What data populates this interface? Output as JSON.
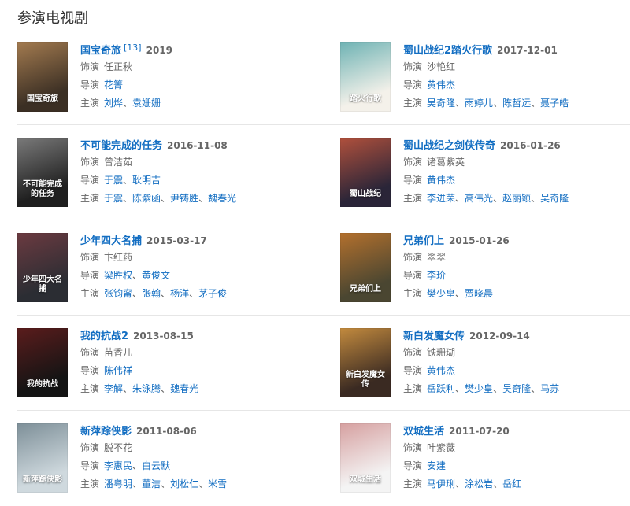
{
  "section": {
    "title": "参演电视剧"
  },
  "rows": [
    [
      {
        "title": "国宝奇旅",
        "sup": "[13]",
        "date": "2019",
        "role_label": "饰演",
        "role": "任正秋",
        "director_label": "导演",
        "directors": [
          "花箐"
        ],
        "cast_label": "主演",
        "cast": [
          "刘烨",
          "袁姗姗"
        ],
        "poster_colors": [
          "#3b2f24",
          "#a27a4f"
        ],
        "poster_text": "国宝奇旅"
      },
      {
        "title": "蜀山战纪2踏火行歌",
        "date": "2017-12-01",
        "role_label": "饰演",
        "role": "沙艳红",
        "director_label": "导演",
        "directors": [
          "黄伟杰"
        ],
        "cast_label": "主演",
        "cast": [
          "吴奇隆",
          "雨婷儿",
          "陈哲远",
          "聂子皓"
        ],
        "poster_colors": [
          "#f4f1ea",
          "#6fb3b4"
        ],
        "poster_text": "踏火行歌"
      }
    ],
    [
      {
        "title": "不可能完成的任务",
        "date": "2016-11-08",
        "role_label": "饰演",
        "role": "曾洁茹",
        "director_label": "导演",
        "directors": [
          "于震",
          "耿明吉"
        ],
        "cast_label": "主演",
        "cast": [
          "于震",
          "陈紫函",
          "尹铸胜",
          "魏春光"
        ],
        "poster_colors": [
          "#1f1f1f",
          "#7a7a7a"
        ],
        "poster_text": "不可能完成的任务"
      },
      {
        "title": "蜀山战纪之剑侠传奇",
        "date": "2016-01-26",
        "role_label": "饰演",
        "role": "诸葛紫英",
        "director_label": "导演",
        "directors": [
          "黄伟杰"
        ],
        "cast_label": "主演",
        "cast": [
          "李进荣",
          "高伟光",
          "赵丽颖",
          "吴奇隆"
        ],
        "poster_colors": [
          "#2a2538",
          "#b0503c"
        ],
        "poster_text": "蜀山战纪"
      }
    ],
    [
      {
        "title": "少年四大名捕",
        "date": "2015-03-17",
        "role_label": "饰演",
        "role": "卞红药",
        "director_label": "导演",
        "directors": [
          "梁胜权",
          "黄俊文"
        ],
        "cast_label": "主演",
        "cast": [
          "张钧甯",
          "张翰",
          "杨洋",
          "茅子俊"
        ],
        "poster_colors": [
          "#2b2d33",
          "#6b3a40"
        ],
        "poster_text": "少年四大名捕"
      },
      {
        "title": "兄弟们上",
        "date": "2015-01-26",
        "role_label": "饰演",
        "role": "翠翠",
        "director_label": "导演",
        "directors": [
          "李玠"
        ],
        "cast_label": "主演",
        "cast": [
          "樊少皇",
          "贾晓晨"
        ],
        "poster_colors": [
          "#4a4631",
          "#b3702d"
        ],
        "poster_text": "兄弟们上"
      }
    ],
    [
      {
        "title": "我的抗战2",
        "date": "2013-08-15",
        "role_label": "饰演",
        "role": "苗香儿",
        "director_label": "导演",
        "directors": [
          "陈伟祥"
        ],
        "cast_label": "主演",
        "cast": [
          "李解",
          "朱泳腾",
          "魏春光"
        ],
        "poster_colors": [
          "#141414",
          "#5a1c1c"
        ],
        "poster_text": "我的抗战"
      },
      {
        "title": "新白发魔女传",
        "date": "2012-09-14",
        "role_label": "饰演",
        "role": "铁珊瑚",
        "director_label": "导演",
        "directors": [
          "黄伟杰"
        ],
        "cast_label": "主演",
        "cast": [
          "岳跃利",
          "樊少皇",
          "吴奇隆",
          "马苏"
        ],
        "poster_colors": [
          "#3a2a22",
          "#c28a3e"
        ],
        "poster_text": "新白发魔女传"
      }
    ],
    [
      {
        "title": "新萍踪侠影",
        "date": "2011-08-06",
        "role_label": "饰演",
        "role": "脱不花",
        "director_label": "导演",
        "directors": [
          "李惠民",
          "白云默"
        ],
        "cast_label": "主演",
        "cast": [
          "潘粤明",
          "董洁",
          "刘松仁",
          "米雪"
        ],
        "poster_colors": [
          "#cfd9de",
          "#7d8f98"
        ],
        "poster_text": "新萍踪侠影"
      },
      {
        "title": "双城生活",
        "date": "2011-07-20",
        "role_label": "饰演",
        "role": "叶紫薇",
        "director_label": "导演",
        "directors": [
          "安建"
        ],
        "cast_label": "主演",
        "cast": [
          "马伊琍",
          "涂松岩",
          "岳红"
        ],
        "poster_colors": [
          "#f4f4f4",
          "#d6a0a0"
        ],
        "poster_text": "双城生活"
      }
    ]
  ]
}
